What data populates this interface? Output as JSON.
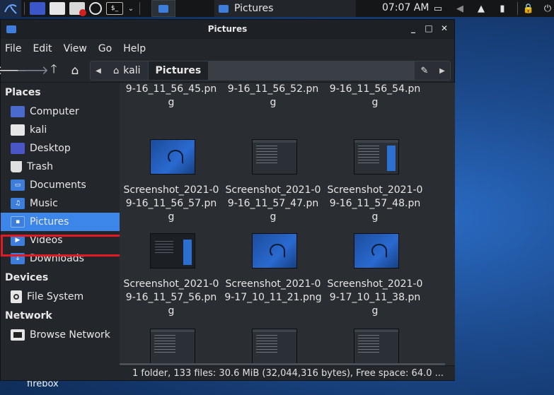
{
  "panel": {
    "task_title": "Pictures",
    "clock": "07:07 AM",
    "terminal_glyph": "$_"
  },
  "window": {
    "title": "Pictures",
    "controls": {
      "minimize": "_",
      "maximize": "□",
      "close": "✕"
    }
  },
  "menu": [
    "File",
    "Edit",
    "View",
    "Go",
    "Help"
  ],
  "pathbar": {
    "crumbs": [
      "kali",
      "Pictures"
    ],
    "active": "Pictures"
  },
  "sidebar": {
    "places_header": "Places",
    "places": [
      {
        "label": "Computer",
        "icon": "computer-icon"
      },
      {
        "label": "kali",
        "icon": "home-folder-icon"
      },
      {
        "label": "Desktop",
        "icon": "desktop-folder-icon"
      },
      {
        "label": "Trash",
        "icon": "trash-icon"
      },
      {
        "label": "Documents",
        "icon": "documents-folder-icon"
      },
      {
        "label": "Music",
        "icon": "music-folder-icon"
      },
      {
        "label": "Pictures",
        "icon": "pictures-folder-icon",
        "selected": true
      },
      {
        "label": "Videos",
        "icon": "videos-folder-icon"
      },
      {
        "label": "Downloads",
        "icon": "downloads-folder-icon"
      }
    ],
    "devices_header": "Devices",
    "devices": [
      {
        "label": "File System",
        "icon": "drive-icon"
      }
    ],
    "network_header": "Network",
    "network": [
      {
        "label": "Browse Network",
        "icon": "network-icon"
      }
    ]
  },
  "files": {
    "row0": [
      "9-16_11_56_45.pn",
      "9-16_11_56_52.pn",
      "9-16_11_56_54.pn"
    ],
    "row0_tail": [
      "g",
      "g",
      "g"
    ],
    "row1": [
      {
        "l1": "Screenshot_2021-0",
        "l2": "9-16_11_56_57.pn",
        "l3": "g",
        "thumb": "kali"
      },
      {
        "l1": "Screenshot_2021-0",
        "l2": "9-16_11_57_47.pn",
        "l3": "g",
        "thumb": "term"
      },
      {
        "l1": "Screenshot_2021-0",
        "l2": "9-16_11_57_48.pn",
        "l3": "g",
        "thumb": "term"
      }
    ],
    "row2": [
      {
        "l1": "Screenshot_2021-0",
        "l2": "9-16_11_57_56.pn",
        "l3": "g",
        "thumb": "dark"
      },
      {
        "l1": "Screenshot_2021-0",
        "l2": "9-17_10_11_21.png",
        "l3": "",
        "thumb": "kali"
      },
      {
        "l1": "Screenshot_2021-0",
        "l2": "9-17_10_11_38.pn",
        "l3": "g",
        "thumb": "kali"
      }
    ]
  },
  "status": "1 folder, 133 files: 30.6 MiB (32,044,316 bytes), Free space: 64.0 ...",
  "desktop": {
    "label": "firebox"
  },
  "colors": {
    "accent": "#3b86e8",
    "highlight": "#e01b24"
  }
}
